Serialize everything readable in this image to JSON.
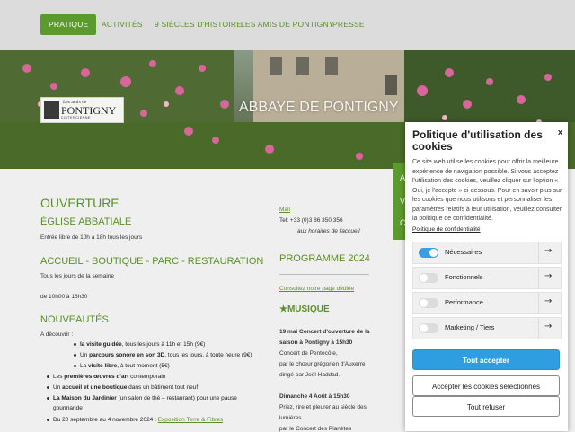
{
  "nav": {
    "items": [
      {
        "label": "PRATIQUE",
        "active": true
      },
      {
        "label": "ACTIVITÉS",
        "active": false
      },
      {
        "label": "9 SIÈCLES D'HISTOIRE",
        "active": false
      },
      {
        "label": "LES AMIS DE PONTIGNY",
        "active": false
      },
      {
        "label": "PRESSE",
        "active": false
      }
    ]
  },
  "hero": {
    "title": "ABBAYE DE PONTIGNY",
    "logo": {
      "small": "Les amis de",
      "big": "PONTIGNY",
      "sub": "ABBAYE CISTERCIENNE"
    }
  },
  "main": {
    "ouverture_heading": "OUVERTURE",
    "eglise_heading": "ÉGLISE ABBATIALE",
    "eglise_text": "Entrée libre de 10h à 18h tous les jours",
    "accueil_heading": "ACCUEIL - BOUTIQUE - PARC - RESTAURATION",
    "accueil_text1": "Tous les jours de la semaine",
    "accueil_text2": "de 10h00 à 18h30",
    "nouveautes_heading": "NOUVEAUTÉS",
    "decouvrir": "A découvrir :",
    "bullets": [
      {
        "bold": "la visite guidée",
        "rest": ", tous les jours à 11h et 15h (9€)"
      },
      {
        "pre": "Un ",
        "bold": "parcours sonore en son 3D",
        "rest": ", tous les jours, à toute heure (9€)"
      },
      {
        "pre": "La ",
        "bold": "visite libre",
        "rest": ", à tout moment (5€)"
      }
    ],
    "bullets2": [
      {
        "pre": "Les ",
        "bold": "premières œuvres d'art",
        "rest": " contemporain"
      },
      {
        "pre": "Un ",
        "bold": "accueil et une boutique",
        "rest": " dans un bâtiment tout neuf"
      },
      {
        "pre": "",
        "bold": "La Maison du Jardinier",
        "rest": " (un salon de thé – restaurant) pour une pause"
      },
      {
        "pre": "",
        "bold": "",
        "rest": "gourmande"
      }
    ],
    "expo_pre": "Du 20 septembre au 4 novembre 2024 : ",
    "expo_link": "Exposition Terre & Fibres"
  },
  "right": {
    "mail": "Mail",
    "tel": "Tel: +33 (0)3 86 350 356",
    "horaires": "aux horaires de l'accueil",
    "programme_heading": "PROGRAMME 2024",
    "programme_link": "Consultez notre page dédiée",
    "musique_heading": "★MUSIQUE",
    "event1_title1": "19 mai Concert d'ouverture de la",
    "event1_title2": "saison à Pontigny à 15h30",
    "event1_line1": "Concert de Pentecôte,",
    "event1_line2": "par le chœur grégorien d'Auxerre",
    "event1_line3": "dirigé par Joël Haddad.",
    "event2_title": "Dimanche 4 Août à 15h30",
    "event2_line1": "Priez, rire et pleurer au siècle des",
    "event2_line2": "lumières",
    "event2_line3": "par le Concert des Planètes"
  },
  "side_tab": {
    "letters": [
      "A",
      "V",
      "C"
    ]
  },
  "cookie": {
    "title": "Politique d'utilisation des cookies",
    "close": "x",
    "body": "Ce site web utilise les cookies pour offrir la meilleure expérience de navigation possible. Si vous acceptez l'utilisation des cookies, veuillez cliquer sur l'option « Oui, je l'accepte » ci-dessous. Pour en savoir plus sur les cookies que nous utilisons et personnaliser les paramètres relatifs à leur utilisation, veuillez consulter la politique de confidentialité.",
    "policy_link": "Politique de confidentialité",
    "categories": [
      {
        "label": "Nécessaires",
        "enabled": true
      },
      {
        "label": "Fonctionnels",
        "enabled": false
      },
      {
        "label": "Performance",
        "enabled": false
      },
      {
        "label": "Marketing / Tiers",
        "enabled": false
      }
    ],
    "accept_all": "Tout accepter",
    "accept_selected": "Accepter les cookies sélectionnés",
    "refuse": "Tout refuser"
  },
  "colors": {
    "brand_green": "#5b8f2b",
    "nav_active": "#5b9a2c",
    "cookie_blue": "#2f9ee0",
    "toggle_on": "#3d9fdf"
  }
}
